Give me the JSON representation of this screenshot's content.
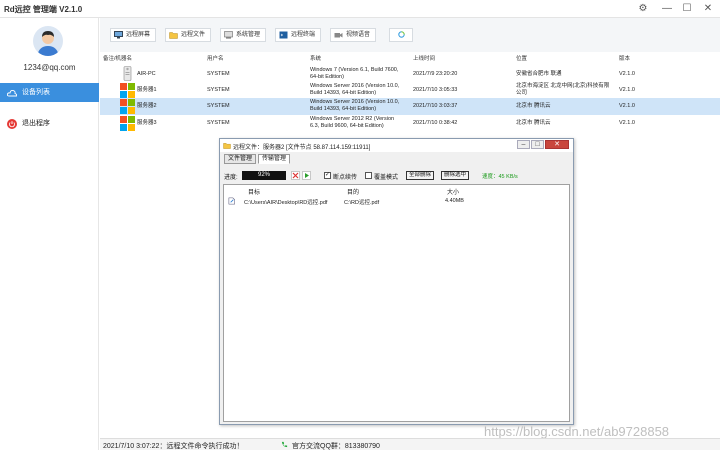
{
  "app": {
    "title": "Rd远控  管理端 V2.1.0"
  },
  "window_controls": {
    "settings": "⚙",
    "minimize": "—",
    "maximize": "☐",
    "close": "✕"
  },
  "sidebar": {
    "username": "1234@qq.com",
    "items": [
      {
        "label": "设备列表",
        "active": true,
        "icon": "cloud-icon"
      },
      {
        "label": "退出程序",
        "active": false,
        "icon": "power-icon"
      }
    ]
  },
  "toolbar": {
    "buttons": [
      {
        "label": "远程屏幕",
        "icon": "monitor-icon"
      },
      {
        "label": "远程文件",
        "icon": "folder-icon"
      },
      {
        "label": "系统管理",
        "icon": "system-icon"
      },
      {
        "label": "远程终端",
        "icon": "terminal-icon"
      },
      {
        "label": "视频语音",
        "icon": "camera-icon"
      },
      {
        "label": "",
        "icon": "refresh-icon"
      }
    ]
  },
  "table": {
    "headers": [
      "备注/机器名",
      "用户名",
      "系统",
      "上线时间",
      "位置",
      "版本"
    ],
    "rows": [
      {
        "name": "AIR-PC",
        "user": "SYSTEM",
        "os1": "Windows 7 (Version 6.1, Build 7600,",
        "os2": "64-bit Edition)",
        "time": "2021/7/9 23:20:20",
        "loc1": "安徽省合肥市 联通",
        "loc2": "",
        "ver": "V2.1.0",
        "selected": false
      },
      {
        "name": "服务器1",
        "user": "SYSTEM",
        "os1": "Windows Server 2016 (Version 10.0,",
        "os2": "Build 14393, 64-bit Edition)",
        "time": "2021/7/10 3:05:33",
        "loc1": "北京市海淀区 北龙中网(北京)科技有限",
        "loc2": "公司",
        "ver": "V2.1.0",
        "selected": false
      },
      {
        "name": "服务器2",
        "user": "SYSTEM",
        "os1": "Windows Server 2016 (Version 10.0,",
        "os2": "Build 14393, 64-bit Edition)",
        "time": "2021/7/10 3:03:37",
        "loc1": "北京市 腾讯云",
        "loc2": "",
        "ver": "V2.1.0",
        "selected": true
      },
      {
        "name": "服务器3",
        "user": "SYSTEM",
        "os1": "Windows Server 2012 R2 (Version",
        "os2": "6.3, Build 9600, 64-bit Edition)",
        "time": "2021/7/10 0:38:42",
        "loc1": "北京市 腾讯云",
        "loc2": "",
        "ver": "V2.1.0",
        "selected": false
      }
    ]
  },
  "dialog": {
    "title": "远程文件：服务器2 [文件节点 58.87.114.159:11911]",
    "tabs": [
      "文件管理",
      "传输管理"
    ],
    "progress_label": "进度:",
    "progress_text": "92%",
    "progress_value": 0.92,
    "resume_label": "断点续传",
    "resume_checked": "✓",
    "overwrite_label": "覆盖模式",
    "btn_delete_all": "全部删除",
    "btn_delete_selected": "删除选中",
    "speed": "速度：45 KB/s",
    "list_headers": [
      "目标",
      "目的",
      "大小"
    ],
    "transfers": [
      {
        "source": "C:\\Users\\AIR\\Desktop\\RD远控.pdf",
        "dest": "C:\\RD远控.pdf",
        "size": "4.40MB"
      }
    ]
  },
  "statusbar": {
    "message": "2021/7/10 3:07:22：远程文件命令执行成功！",
    "qq_group": "官方交流QQ群：813380790"
  },
  "watermark": "https://blog.csdn.net/ab9728858",
  "colors": {
    "accent": "#3a8fde",
    "selected_row": "#cfe4f8",
    "speed": "#1a9a1a",
    "qq_icon": "#21a83a"
  }
}
